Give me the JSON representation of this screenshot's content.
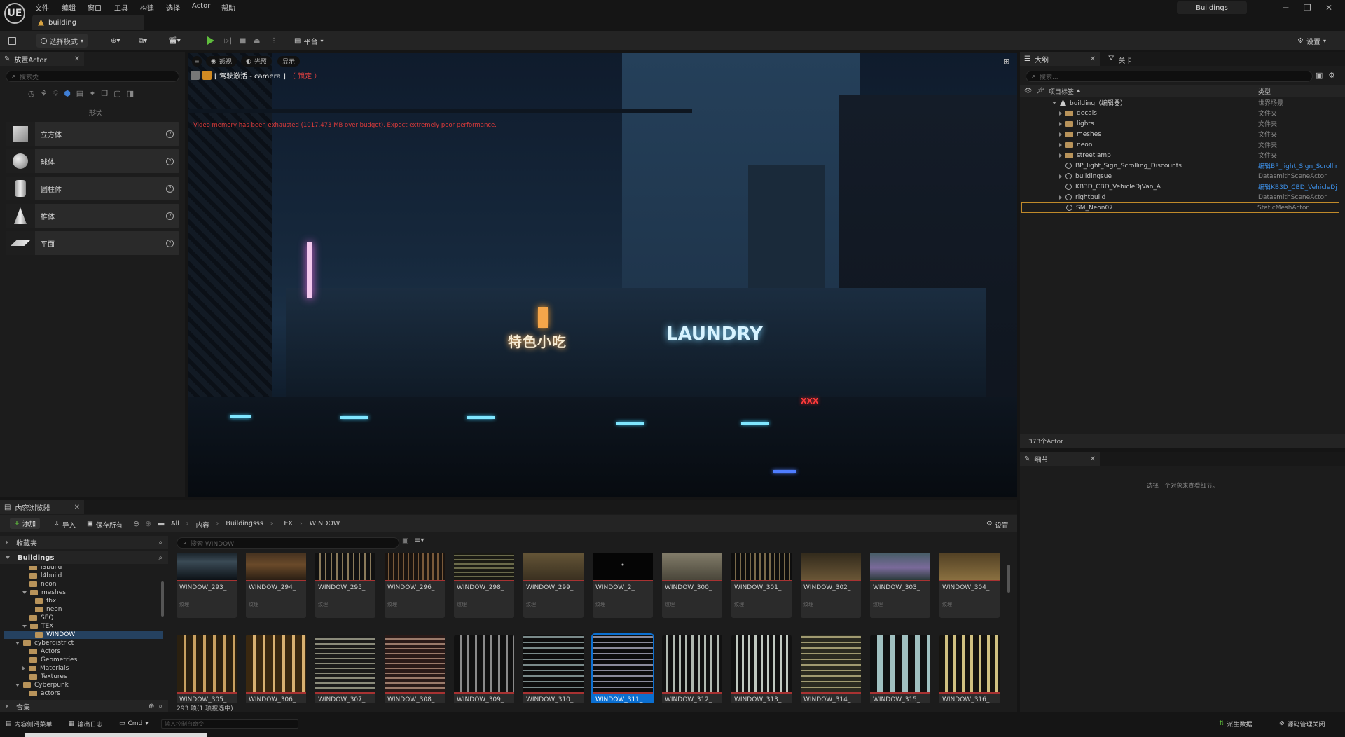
{
  "window": {
    "logo": "UE",
    "menu": [
      "文件",
      "编辑",
      "窗口",
      "工具",
      "构建",
      "选择",
      "Actor",
      "帮助"
    ],
    "doc_tab": "building",
    "project": "Buildings",
    "controls": [
      "minimize-icon",
      "restore-icon",
      "close-icon"
    ]
  },
  "toolbar": {
    "mode": "选择模式",
    "platform": "平台",
    "settings": "设置"
  },
  "place_actor": {
    "tab": "放置Actor",
    "search_placeholder": "搜索类",
    "category": "形状",
    "shapes": [
      "立方体",
      "球体",
      "圆柱体",
      "椎体",
      "平面"
    ]
  },
  "viewport": {
    "pills": [
      "透视",
      "光照",
      "显示"
    ],
    "camera_label": "[ 驾驶激活 - camera ]",
    "camera_lock": "（ 锁定 ）",
    "warning": "Video memory has been exhausted (1017.473 MB over budget). Expect extremely poor performance.",
    "signs": {
      "laundry": "LAUNDRY",
      "chinese_sign": "特色小吃",
      "xxx": "XXX"
    }
  },
  "outliner": {
    "tab_outliner": "大纲",
    "tab_levels": "关卡",
    "search_placeholder": "搜索...",
    "col_label": "项目标签",
    "col_type": "类型",
    "rows": [
      {
        "label": "building（编辑器）",
        "type": "世界场景",
        "kind": "world",
        "indent": 0
      },
      {
        "label": "decals",
        "type": "文件夹",
        "kind": "folder",
        "indent": 1
      },
      {
        "label": "lights",
        "type": "文件夹",
        "kind": "folder",
        "indent": 1
      },
      {
        "label": "meshes",
        "type": "文件夹",
        "kind": "folder",
        "indent": 1
      },
      {
        "label": "neon",
        "type": "文件夹",
        "kind": "folder",
        "indent": 1
      },
      {
        "label": "streetlamp",
        "type": "文件夹",
        "kind": "folder",
        "indent": 1
      },
      {
        "label": "BP_light_Sign_Scrolling_Discounts",
        "type": "编辑BP_light_Sign_Scrollir",
        "kind": "link",
        "indent": 1
      },
      {
        "label": "buildingsue",
        "type": "DatasmithSceneActor",
        "kind": "actor",
        "indent": 1
      },
      {
        "label": "KB3D_CBD_VehicleDjVan_A",
        "type": "编辑KB3D_CBD_VehicleDj",
        "kind": "link",
        "indent": 1
      },
      {
        "label": "rightbuild",
        "type": "DatasmithSceneActor",
        "kind": "actor",
        "indent": 1
      },
      {
        "label": "SM_Neon07",
        "type": "StaticMeshActor",
        "kind": "selected",
        "indent": 1
      }
    ],
    "count": "373个Actor"
  },
  "details": {
    "tab": "细节",
    "empty": "选择一个对象来查看细节。"
  },
  "content_browser": {
    "tab": "内容浏览器",
    "add": "添加",
    "import": "导入",
    "save_all": "保存所有",
    "breadcrumb": [
      "All",
      "内容",
      "Buildingsss",
      "TEX",
      "WINDOW"
    ],
    "settings": "设置",
    "favorites": "收藏夹",
    "root": "Buildings",
    "tree": [
      {
        "label": "l3build",
        "indent": 2
      },
      {
        "label": "l4build",
        "indent": 2
      },
      {
        "label": "neon",
        "indent": 2
      },
      {
        "label": "meshes",
        "indent": 1
      },
      {
        "label": "fbx",
        "indent": 2
      },
      {
        "label": "neon",
        "indent": 2
      },
      {
        "label": "SEQ",
        "indent": 1
      },
      {
        "label": "TEX",
        "indent": 1
      },
      {
        "label": "WINDOW",
        "indent": 2
      },
      {
        "label": "cyberdistrict",
        "indent": 0
      },
      {
        "label": "Actors",
        "indent": 1
      },
      {
        "label": "Geometries",
        "indent": 1
      },
      {
        "label": "Materials",
        "indent": 1
      },
      {
        "label": "Textures",
        "indent": 1
      },
      {
        "label": "Cyberpunk",
        "indent": 0
      },
      {
        "label": "actors",
        "indent": 1
      }
    ],
    "collections": "合集",
    "search_placeholder": "搜索 WINDOW",
    "asset_type": "纹理",
    "assets_row1": [
      "WINDOW_293_",
      "WINDOW_294_",
      "WINDOW_295_",
      "WINDOW_296_",
      "WINDOW_298_",
      "WINDOW_299_",
      "WINDOW_2_",
      "WINDOW_300_",
      "WINDOW_301_",
      "WINDOW_302_",
      "WINDOW_303_",
      "WINDOW_304_"
    ],
    "assets_row2": [
      "WINDOW_305_",
      "WINDOW_306_",
      "WINDOW_307_",
      "WINDOW_308_",
      "WINDOW_309_",
      "WINDOW_310_",
      "WINDOW_311_",
      "WINDOW_312_",
      "WINDOW_313_",
      "WINDOW_314_",
      "WINDOW_315_",
      "WINDOW_316_"
    ],
    "selected_asset": "WINDOW_311_",
    "status": "293 项(1 项被选中)"
  },
  "statusbar": {
    "content_drawer": "内容侧滑菜单",
    "output_log": "输出日志",
    "cmd": "Cmd",
    "console_placeholder": "输入控制台命令",
    "derived_data": "派生数据",
    "source_control": "源码管理关闭"
  },
  "colors": {
    "accent_blue": "#0b6fd1",
    "play_green": "#5fbd3d",
    "warning_red": "#e03b3b",
    "selection_border": "#c08a2a"
  }
}
